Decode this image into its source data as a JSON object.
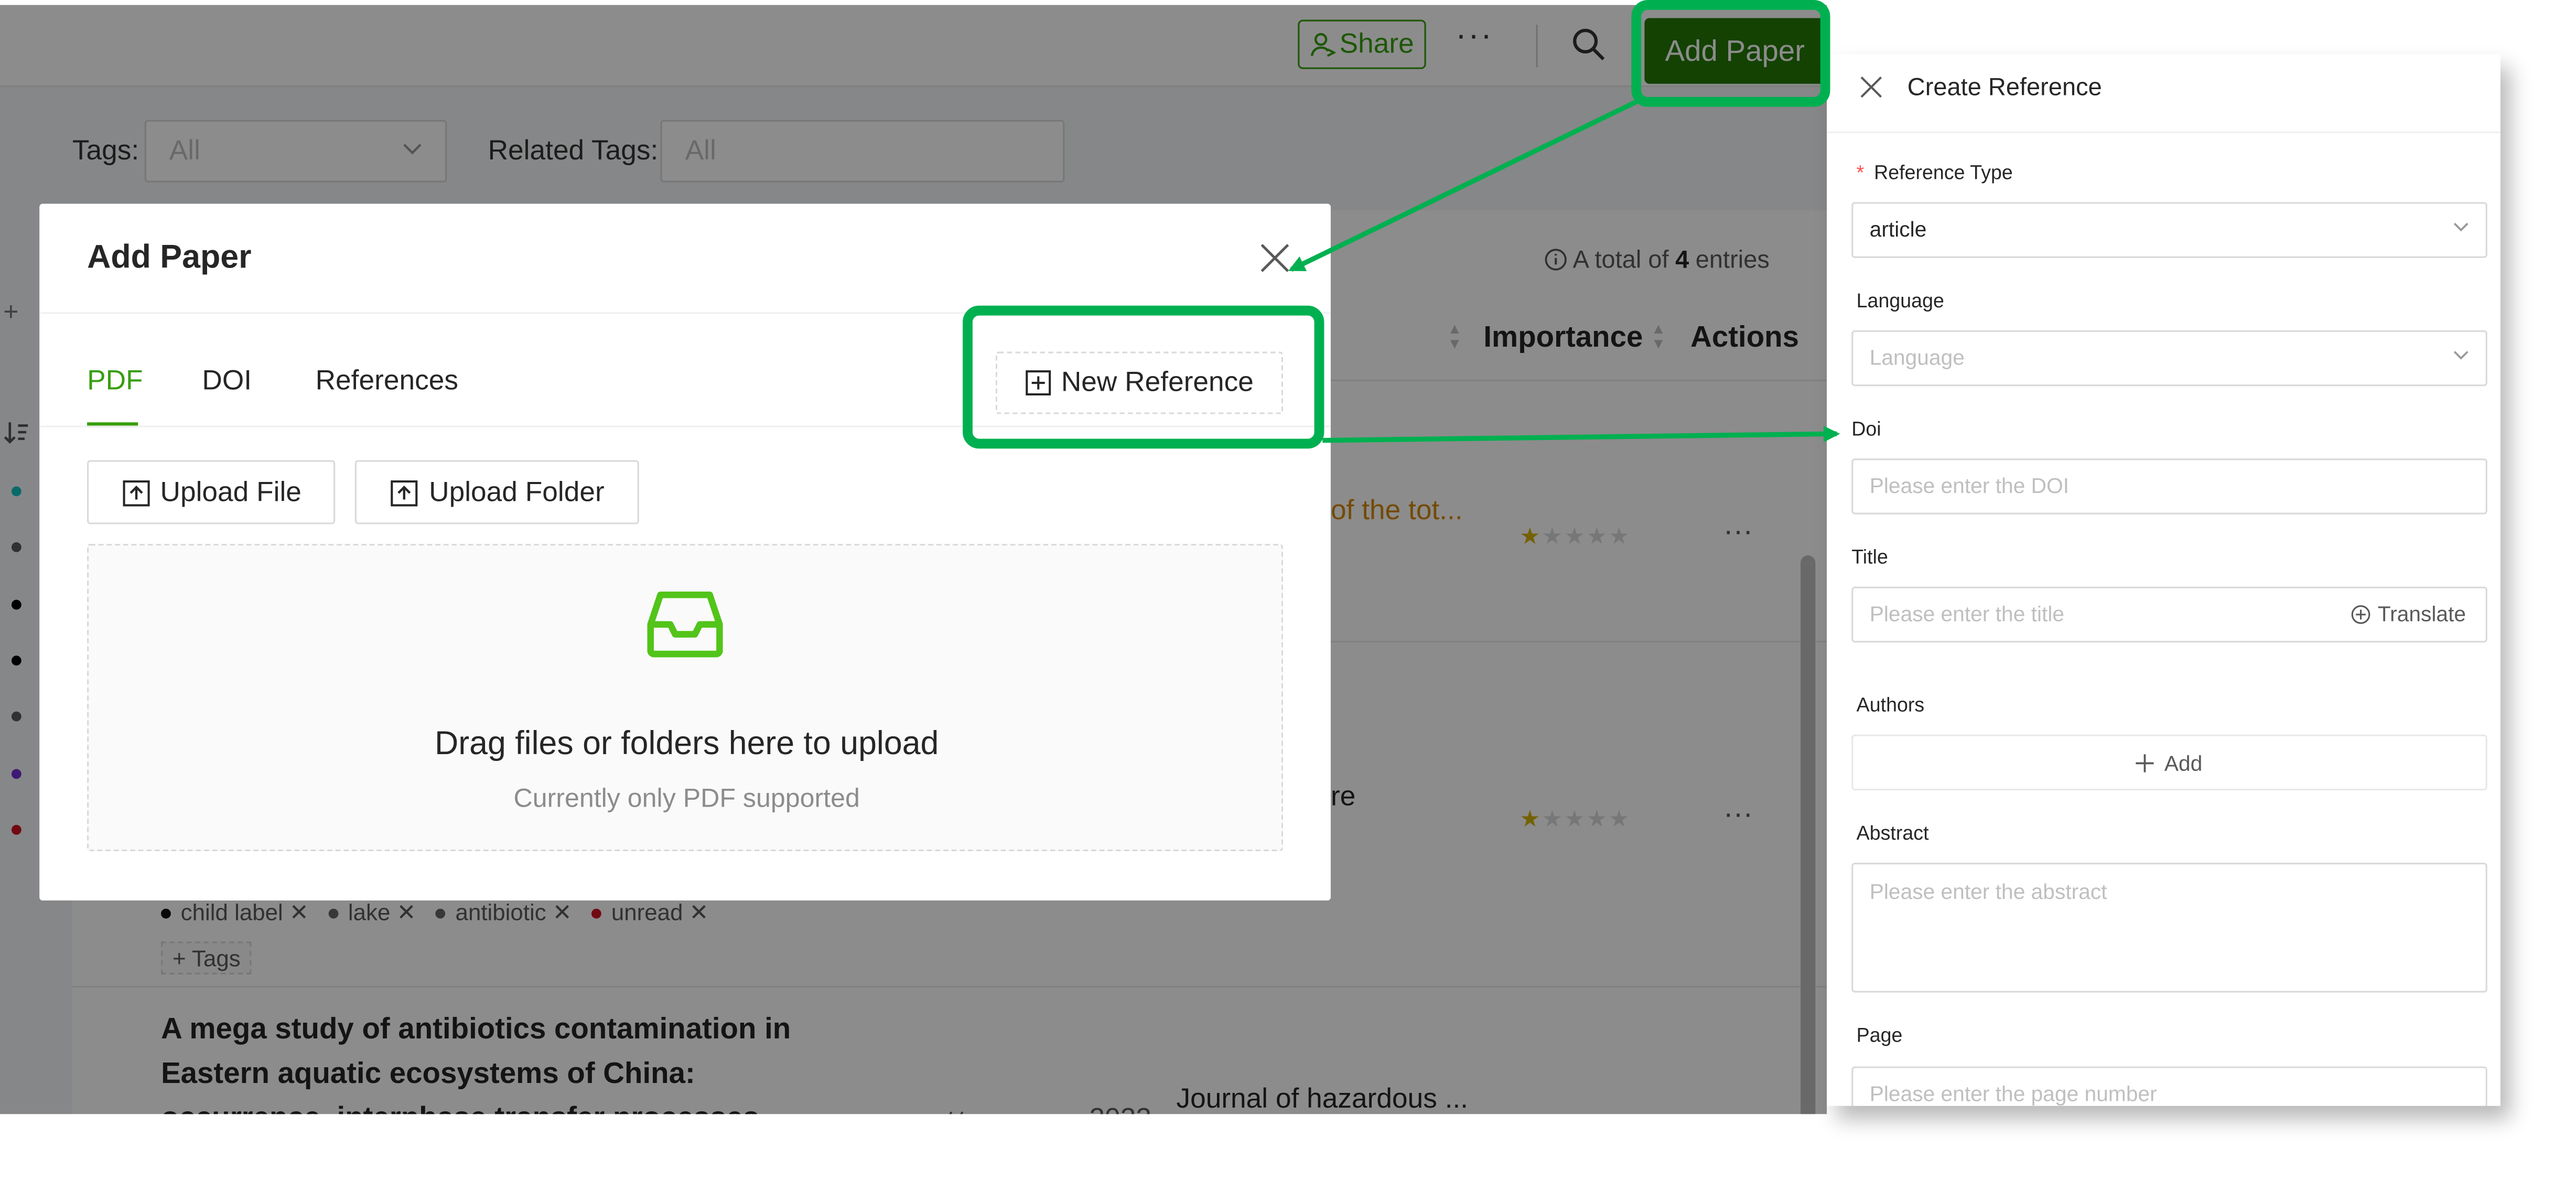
{
  "topbar": {
    "share_label": "Share",
    "more_label": "···",
    "add_paper_label": "Add Paper"
  },
  "filters": {
    "tags_label": "Tags:",
    "tags_value": "All",
    "related_label": "Related Tags:",
    "related_value": "All"
  },
  "list": {
    "total_prefix": "A total of",
    "total_count": "4",
    "total_suffix": "entries",
    "columns": {
      "importance": "Importance",
      "actions": "Actions"
    },
    "row1_snippet": "of the tot...",
    "row2_snippet": "re",
    "row_more": "···",
    "tags": [
      "child label",
      "lake",
      "antibiotic",
      "unread"
    ],
    "tag_colors": [
      "#111111",
      "#666666",
      "#666666",
      "#cf1322"
    ],
    "add_tags_label": "+ Tags",
    "paper_title": "A mega study of antibiotics contamination in Eastern aquatic ecosystems of China: occurrence, interphase transfer processes",
    "paper_authors": "Ou ... 等",
    "paper_year": "2022",
    "paper_journal": "Journal of hazardous ...",
    "importance_stars": 1,
    "importance_max": 5,
    "left_dot_colors": [
      "#13c2c2",
      "#595959",
      "#000000",
      "#000000",
      "#595959",
      "#722ed1",
      "#cf1322"
    ]
  },
  "modal": {
    "title": "Add Paper",
    "tabs": [
      "PDF",
      "DOI",
      "References"
    ],
    "active_tab": "PDF",
    "new_reference_label": "New Reference",
    "upload_file_label": "Upload File",
    "upload_folder_label": "Upload Folder",
    "drop_text": "Drag files or folders here to upload",
    "drop_hint": "Currently only PDF supported"
  },
  "drawer": {
    "title": "Create Reference",
    "reference_type_label": "Reference Type",
    "reference_type_value": "article",
    "language_label": "Language",
    "language_placeholder": "Language",
    "doi_label": "Doi",
    "doi_placeholder": "Please enter the DOI",
    "title_label": "Title",
    "title_placeholder": "Please enter the title",
    "translate_label": "Translate",
    "authors_label": "Authors",
    "authors_add_label": "Add",
    "abstract_label": "Abstract",
    "abstract_placeholder": "Please enter the abstract",
    "page_label": "Page",
    "page_placeholder": "Please enter the page number"
  },
  "colors": {
    "accent": "#389e0d",
    "primary_button": "#237804",
    "annotation": "#00b050"
  }
}
